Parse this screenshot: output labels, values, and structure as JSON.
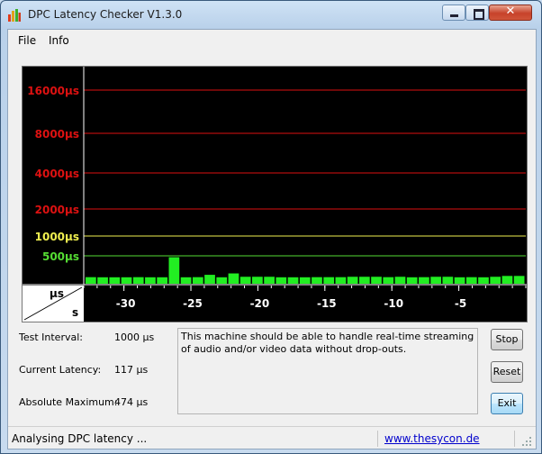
{
  "window": {
    "title": "DPC Latency Checker V1.3.0",
    "close_glyph": "✕"
  },
  "menu": {
    "file": "File",
    "info": "Info"
  },
  "chart_data": {
    "type": "bar",
    "y_axis_labels": [
      {
        "label": "16000µs",
        "value": 16000,
        "color": "#dd1111"
      },
      {
        "label": "8000µs",
        "value": 8000,
        "color": "#dd1111"
      },
      {
        "label": "4000µs",
        "value": 4000,
        "color": "#dd1111"
      },
      {
        "label": "2000µs",
        "value": 2000,
        "color": "#dd1111"
      },
      {
        "label": "1000µs",
        "value": 1000,
        "color": "#f0f050"
      },
      {
        "label": "500µs",
        "value": 500,
        "color": "#55dd33"
      }
    ],
    "corner_y_unit": "µs",
    "corner_x_unit": "s",
    "x_tick_labels": [
      {
        "label": "-30",
        "value": -30
      },
      {
        "label": "-25",
        "value": -25
      },
      {
        "label": "-20",
        "value": -20
      },
      {
        "label": "-15",
        "value": -15
      },
      {
        "label": "-10",
        "value": -10
      },
      {
        "label": "-5",
        "value": -5
      }
    ],
    "x_range": [
      -33,
      0
    ],
    "bar_color": "#22ee22",
    "values_us": [
      118,
      116,
      116,
      116,
      118,
      116,
      116,
      475,
      116,
      118,
      160,
      116,
      185,
      125,
      125,
      125,
      116,
      116,
      116,
      118,
      118,
      118,
      125,
      125,
      125,
      118,
      125,
      116,
      118,
      125,
      125,
      116,
      118,
      116,
      125,
      140,
      140
    ]
  },
  "info": {
    "test_interval_label": "Test Interval:",
    "test_interval_value": "1000 µs",
    "current_latency_label": "Current Latency:",
    "current_latency_value": "117 µs",
    "absolute_max_label": "Absolute Maximum:",
    "absolute_max_value": "474 µs"
  },
  "message": "This machine should be able to handle real-time streaming of audio and/or video data without drop-outs.",
  "buttons": {
    "stop": "Stop",
    "reset": "Reset",
    "exit": "Exit"
  },
  "status": {
    "text": "Analysing DPC latency ...",
    "link": "www.thesycon.de"
  }
}
